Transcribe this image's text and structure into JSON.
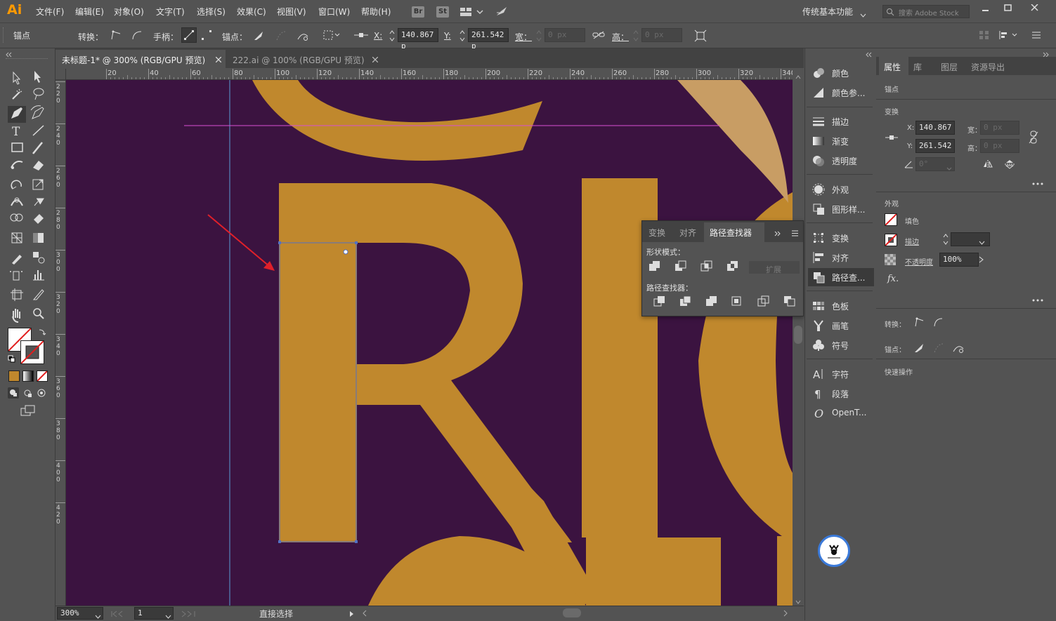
{
  "app": {
    "logo": "Ai",
    "workspace": "传统基本功能",
    "search_placeholder": "搜索 Adobe Stock",
    "bridge": "Br",
    "stock": "St"
  },
  "menu": [
    "文件(F)",
    "编辑(E)",
    "对象(O)",
    "文字(T)",
    "选择(S)",
    "效果(C)",
    "视图(V)",
    "窗口(W)",
    "帮助(H)"
  ],
  "control": {
    "mode": "锚点",
    "convert_label": "转换：",
    "handle_label": "手柄：",
    "anchor_label": "锚点：",
    "x_label": "X:",
    "x_value": "140.867 p",
    "y_label": "Y:",
    "y_value": "261.542 p",
    "w_label": "宽：",
    "w_value": "0 px",
    "h_label": "高：",
    "h_value": "0 px"
  },
  "tabs": [
    {
      "label": "未标题-1* @ 300% (RGB/GPU 预览)",
      "active": true
    },
    {
      "label": "222.ai @ 100% (RGB/GPU 预览)",
      "active": false
    }
  ],
  "ruler": {
    "h_ticks": [
      "20",
      "40",
      "60",
      "80",
      "100",
      "120",
      "140",
      "160",
      "180",
      "200",
      "220",
      "240",
      "260",
      "280",
      "300",
      "320",
      "340"
    ],
    "v_ticks": [
      "2\n2\n0",
      "2\n4\n0",
      "2\n6\n0",
      "2\n8\n0",
      "3\n0\n0",
      "3\n2\n0",
      "3\n4\n0",
      "3\n6\n0",
      "3\n8\n0",
      "4\n0\n0",
      "4\n2\n0"
    ]
  },
  "pathfinder": {
    "tabs": [
      "变换",
      "对齐",
      "路径查找器"
    ],
    "shape_modes": "形状模式：",
    "expand": "扩展",
    "pathfinders": "路径查找器："
  },
  "dock": [
    {
      "label": "颜色",
      "icon": "color-icon"
    },
    {
      "label": "颜色参...",
      "icon": "color-guide-icon"
    },
    {
      "label": "描边",
      "icon": "stroke-icon"
    },
    {
      "label": "渐变",
      "icon": "gradient-icon"
    },
    {
      "label": "透明度",
      "icon": "transparency-icon"
    },
    {
      "label": "外观",
      "icon": "appearance-icon"
    },
    {
      "label": "图形样...",
      "icon": "graphic-styles-icon"
    },
    {
      "label": "变换",
      "icon": "transform-icon"
    },
    {
      "label": "对齐",
      "icon": "align-icon"
    },
    {
      "label": "路径查...",
      "icon": "pathfinder-icon"
    },
    {
      "label": "色板",
      "icon": "swatches-icon"
    },
    {
      "label": "画笔",
      "icon": "brushes-icon"
    },
    {
      "label": "符号",
      "icon": "symbols-icon"
    },
    {
      "label": "字符",
      "icon": "character-icon"
    },
    {
      "label": "段落",
      "icon": "paragraph-icon"
    },
    {
      "label": "OpenT...",
      "icon": "opentype-icon"
    }
  ],
  "props": {
    "tabs": [
      "属性",
      "库",
      "图层",
      "资源导出"
    ],
    "anchor": "锚点",
    "transform": "变换",
    "x_label": "X:",
    "x_value": "140.867",
    "y_label": "Y:",
    "y_value": "261.542",
    "w_label": "宽：",
    "w_value": "0 px",
    "h_label": "高：",
    "h_value": "0 px",
    "angle_value": "0°",
    "appearance": "外观",
    "fill": "填色",
    "stroke": "描边",
    "opacity_label": "不透明度",
    "opacity_value": "100%",
    "fx": "fx.",
    "convert": "转换：",
    "anchor_points": "锚点：",
    "quick_actions": "快速操作"
  },
  "status": {
    "zoom": "300%",
    "artboard": "1",
    "tool": "直接选择"
  },
  "colors": {
    "canvas": "#3b1340",
    "letters": "#c0882d",
    "letters_light": "#c89d64",
    "guide": "#5b9bd5",
    "path": "#5271c4",
    "magenta": "#d94fd5",
    "arrow": "#e0202a"
  }
}
